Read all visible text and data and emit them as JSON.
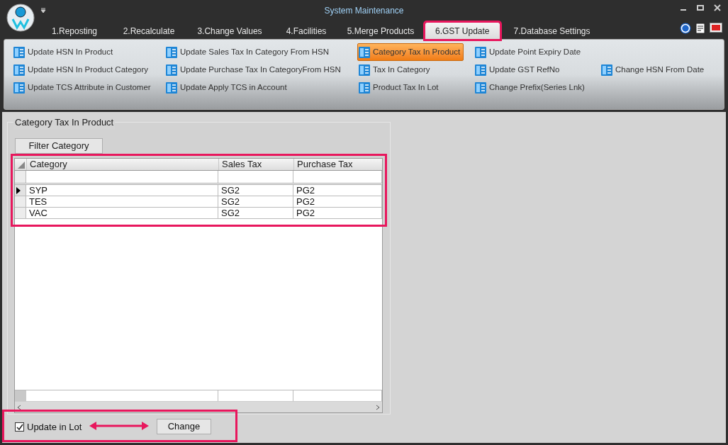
{
  "window": {
    "title": "System Maintenance"
  },
  "tabs": [
    {
      "label": "1.Reposting",
      "selected": false
    },
    {
      "label": "2.Recalculate",
      "selected": false
    },
    {
      "label": "3.Change Values",
      "selected": false
    },
    {
      "label": "4.Facilities",
      "selected": false
    },
    {
      "label": "5.Merge Products",
      "selected": false
    },
    {
      "label": "6.GST Update",
      "selected": true
    },
    {
      "label": "7.Database Settings",
      "selected": false
    }
  ],
  "ribbon": {
    "rows": [
      [
        {
          "label": "Update HSN In Product",
          "selected": false
        },
        {
          "label": "Update Sales Tax In Category From HSN",
          "selected": false
        },
        {
          "label": "Category Tax In Product",
          "selected": true
        },
        {
          "label": "Update Point Expiry Date",
          "selected": false
        }
      ],
      [
        {
          "label": "Update HSN In Product Category",
          "selected": false
        },
        {
          "label": "Update Purchase Tax In CategoryFrom HSN",
          "selected": false
        },
        {
          "label": "Tax In Category",
          "selected": false
        },
        {
          "label": "Update GST RefNo",
          "selected": false
        },
        {
          "label": "Change HSN From Date",
          "selected": false
        }
      ],
      [
        {
          "label": "Update TCS Attribute in Customer",
          "selected": false
        },
        {
          "label": "Update Apply TCS in Account",
          "selected": false
        },
        {
          "label": "Product Tax In Lot",
          "selected": false
        },
        {
          "label": "Change Prefix(Series Lnk)",
          "selected": false
        }
      ]
    ]
  },
  "panel": {
    "title": "Category Tax In Product",
    "filter_button": "Filter Category",
    "table": {
      "columns": [
        "Category",
        "Sales Tax",
        "Purchase Tax"
      ],
      "rows": [
        {
          "cells": [
            "SYP",
            "SG2",
            "PG2"
          ],
          "current": true
        },
        {
          "cells": [
            "TES",
            "SG2",
            "PG2"
          ],
          "current": false
        },
        {
          "cells": [
            "VAC",
            "SG2",
            "PG2"
          ],
          "current": false
        }
      ]
    },
    "update_in_lot": {
      "label": "Update in Lot",
      "checked": true
    },
    "change_button": "Change"
  }
}
